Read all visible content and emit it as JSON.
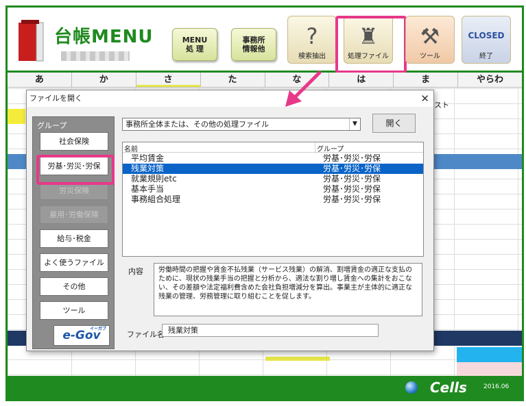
{
  "header": {
    "app_title": "台帳MENU",
    "buttons": {
      "menu_shori": "MENU\n処 理",
      "jimusho": "事務所\n情報他",
      "kensaku": "検索抽出",
      "shori_file": "処理ファイル",
      "tool": "ツール",
      "closed_top": "CLOSED",
      "closed_bottom": "終了"
    }
  },
  "sheet": {
    "columns": [
      "あ",
      "か",
      "さ",
      "た",
      "な",
      "は",
      "ま",
      "やらわ"
    ],
    "stray": "スト"
  },
  "footer": {
    "brand": "Cells",
    "version": "2016.06"
  },
  "dialog": {
    "title": "ファイルを開く",
    "close": "✕",
    "group_label": "グループ",
    "groups": [
      {
        "label": "社会保険",
        "state": "normal"
      },
      {
        "label": "労基･労災･労保",
        "state": "active"
      },
      {
        "label": "労災保険",
        "state": "disabled"
      },
      {
        "label": "雇用･労働保険",
        "state": "disabled"
      },
      {
        "label": "給与･税金",
        "state": "normal"
      },
      {
        "label": "よく使うファイル",
        "state": "normal"
      },
      {
        "label": "その他",
        "state": "normal"
      },
      {
        "label": "ツール",
        "state": "normal"
      }
    ],
    "egov": "e-Gov",
    "egov_sub": "イーガブ",
    "dropdown_value": "事務所全体または、その他の処理ファイル",
    "open_button": "開く",
    "list_headers": {
      "name": "名前",
      "group": "グループ"
    },
    "files": [
      {
        "name": "平均賃金",
        "group": "労基･労災･労保",
        "selected": false
      },
      {
        "name": "残業対策",
        "group": "労基･労災･労保",
        "selected": true
      },
      {
        "name": "就業規則etc",
        "group": "労基･労災･労保",
        "selected": false
      },
      {
        "name": "基本手当",
        "group": "労基･労災･労保",
        "selected": false
      },
      {
        "name": "事務組合処理",
        "group": "労基･労災･労保",
        "selected": false
      }
    ],
    "desc_label": "内容",
    "description": "労働時間の把握や賃金不払残業（サービス残業）の解消、割増賃金の適正な支払のために、現状の残業手当の把握と分析から、適法な割り増し賃金への集計をおこない、その差額や法定福利費含めた会社負担増減分を算出。事業主が主体的に適正な残業の管理、労務管理に取り組むことを促します。",
    "filename_label": "ファイル名",
    "filename_value": "残業対策"
  },
  "colors": {
    "frame_green": "#1f8a1f",
    "highlight_pink": "#e8388a",
    "selection_blue": "#0a64c8"
  }
}
